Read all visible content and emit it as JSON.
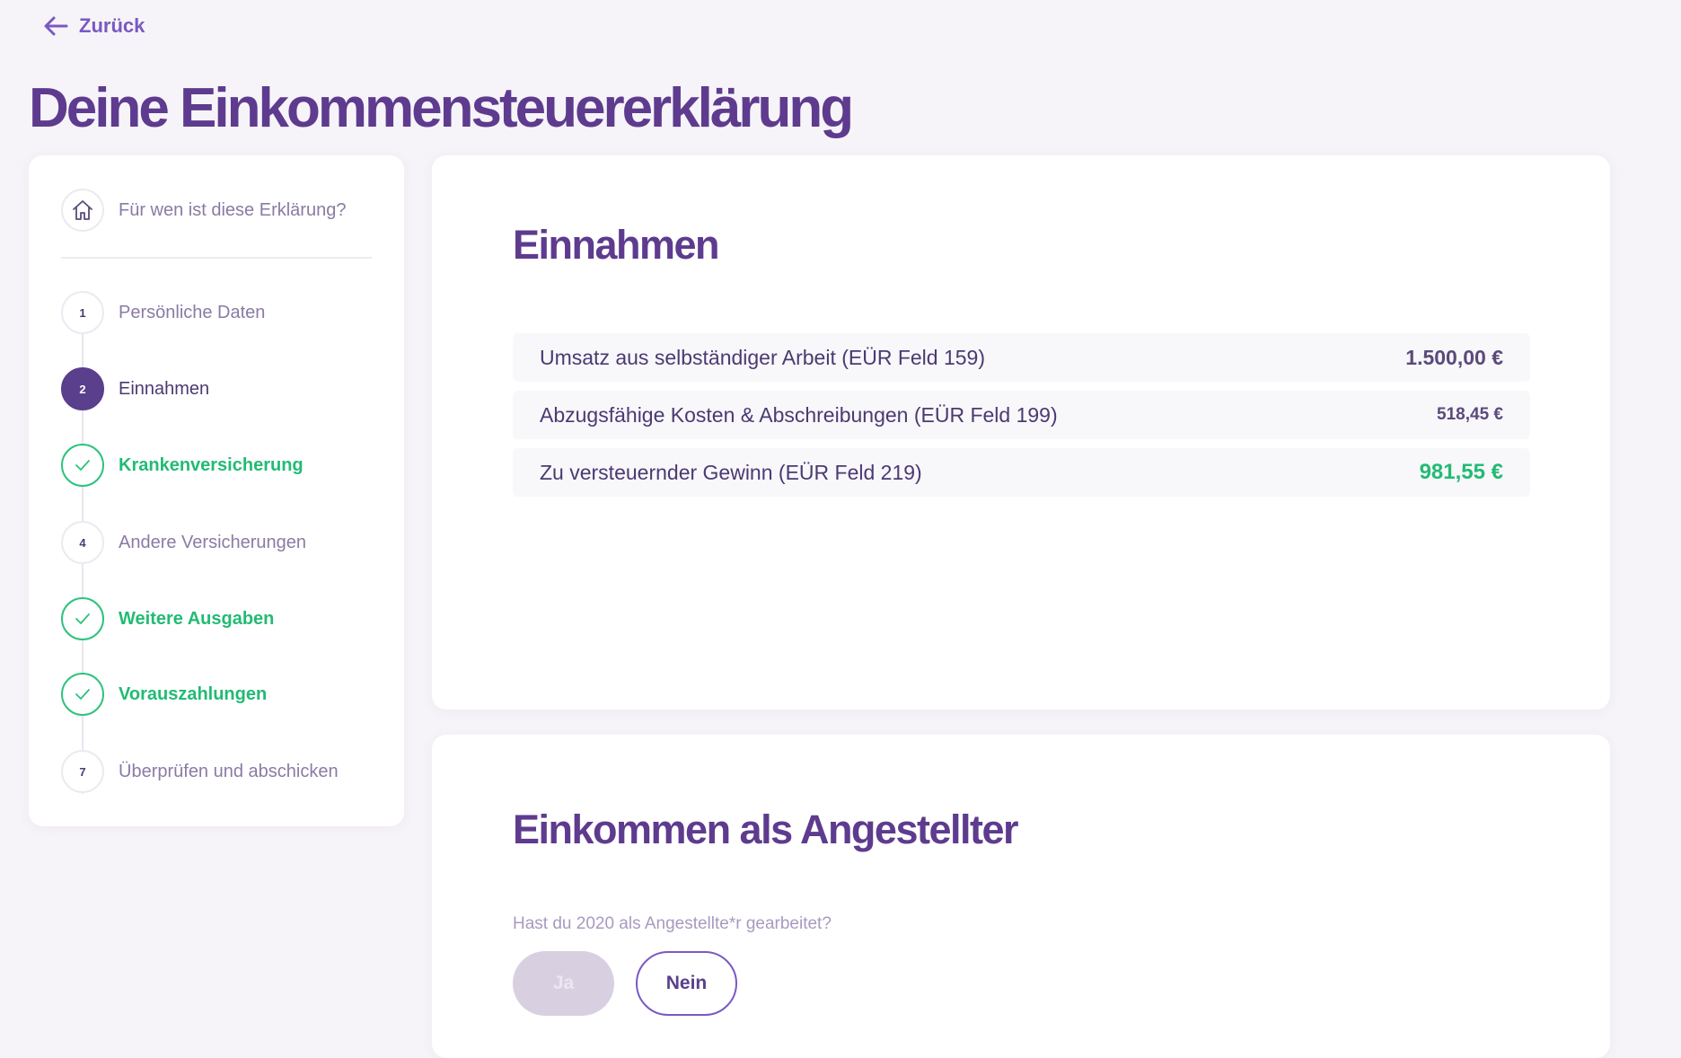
{
  "nav": {
    "back_label": "Zurück"
  },
  "page": {
    "title": "Deine Einkommensteuererklärung"
  },
  "sidebar": {
    "home_label": "Für wen ist diese Erklärung?",
    "steps": [
      {
        "number": "1",
        "label": "Persönliche Daten",
        "status": "pending"
      },
      {
        "number": "2",
        "label": "Einnahmen",
        "status": "active"
      },
      {
        "number": "",
        "label": "Krankenversicherung",
        "status": "done"
      },
      {
        "number": "4",
        "label": "Andere Versicherungen",
        "status": "pending"
      },
      {
        "number": "",
        "label": "Weitere Ausgaben",
        "status": "done"
      },
      {
        "number": "",
        "label": "Vorauszahlungen",
        "status": "done"
      },
      {
        "number": "7",
        "label": "Überprüfen und abschicken",
        "status": "pending"
      }
    ]
  },
  "income": {
    "title": "Einnahmen",
    "rows": [
      {
        "label": "Umsatz aus selbständiger Arbeit (EÜR Feld 159)",
        "value": "1.500,00 €"
      },
      {
        "label": "Abzugsfähige Kosten & Abschreibungen (EÜR Feld 199)",
        "value": "518,45 €"
      },
      {
        "label": "Zu versteuernder Gewinn (EÜR Feld 219)",
        "value": "981,55 €"
      }
    ]
  },
  "employed": {
    "title": "Einkommen als Angestellter",
    "question": "Hast du 2020 als Angestellte*r gearbeitet?",
    "yes_label": "Ja",
    "no_label": "Nein"
  },
  "colors": {
    "brand_purple": "#5e3b8e",
    "accent_purple": "#7a59c2",
    "success_green": "#22bb74"
  },
  "icons": {
    "back": "arrow-left-icon",
    "home": "home-icon",
    "done": "checkmark-icon"
  }
}
